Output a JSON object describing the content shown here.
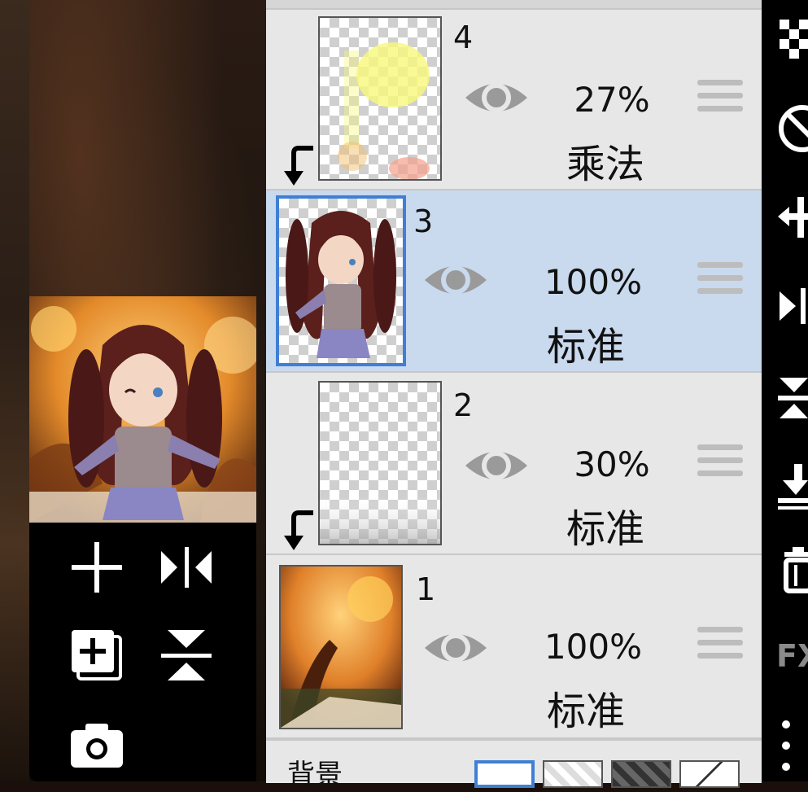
{
  "layers": [
    {
      "number": "4",
      "opacity": "27%",
      "mode": "乘法",
      "visible": true,
      "clipped": true,
      "selected": false
    },
    {
      "number": "3",
      "opacity": "100%",
      "mode": "标准",
      "visible": true,
      "clipped": false,
      "selected": true
    },
    {
      "number": "2",
      "opacity": "30%",
      "mode": "标准",
      "visible": true,
      "clipped": true,
      "selected": false
    },
    {
      "number": "1",
      "opacity": "100%",
      "mode": "标准",
      "visible": true,
      "clipped": false,
      "selected": false
    }
  ],
  "bottom_bar": {
    "background_label": "背景"
  },
  "right_toolbar": {
    "fx_label": "FX"
  },
  "colors": {
    "panel_bg": "#e7e7e7",
    "selected_row": "#c9d9ee",
    "selected_border": "#3f7fd4",
    "toolbar_bg": "#000000",
    "icon_gray": "#9a9a9a"
  },
  "icons": [
    "add-layer-icon",
    "flip-horizontal-icon",
    "duplicate-layer-icon",
    "flip-vertical-icon",
    "camera-icon",
    "eye-icon",
    "drag-handle-icon",
    "clip-arrow-icon",
    "transparency-icon",
    "opacity-icon",
    "move-icon",
    "merge-down-icon",
    "delete-layer-icon",
    "more-icon"
  ]
}
